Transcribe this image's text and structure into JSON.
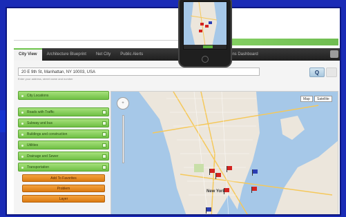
{
  "nav": {
    "tabs": [
      "City View",
      "Architecture Blueprint",
      "Net City",
      "Public Alerts",
      "Operations Dashboard"
    ]
  },
  "search": {
    "address": "20 E 9th St, Manhattan, NY 10003, USA",
    "hint": "Enter your address, street name and number"
  },
  "find_label": "Q",
  "sidebar": {
    "layers_label": "City Locations",
    "items": [
      "Roads with Traffic",
      "Subway and bus",
      "Buildings and construction",
      "Utilities",
      "Drainage and Sewer",
      "Transportation"
    ],
    "buttons": [
      "Add To Favorites",
      "Problem",
      "Layer"
    ]
  },
  "map": {
    "type_buttons": [
      "Map",
      "Satellite"
    ],
    "city_label": "New York",
    "pan_label": "+"
  },
  "colors": {
    "accent_green": "#6fbf45",
    "orange": "#dc7b12",
    "background": "#1a2bb6"
  }
}
